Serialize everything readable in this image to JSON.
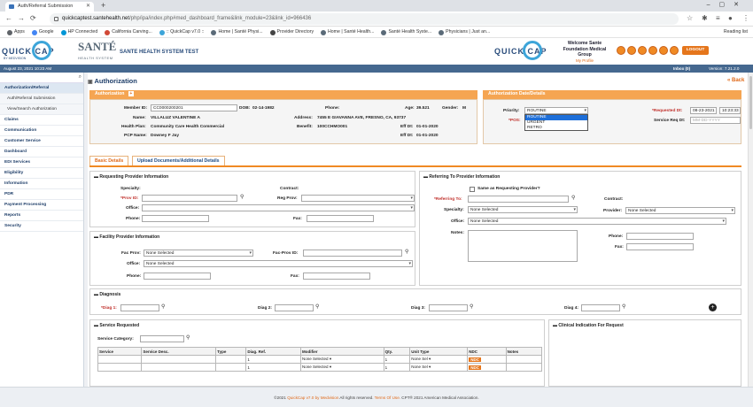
{
  "browser": {
    "tab_title": "Auth/Referral Submission",
    "url_host": "quickcaptest.santehealth.net",
    "url_path": "/php/ipa/index.php#med_dashboard_frame&link_module=23&link_id=966436",
    "bookmarks": [
      {
        "label": "Apps",
        "color": "#5f6368"
      },
      {
        "label": "Google",
        "color": "#4285f4"
      },
      {
        "label": "HP Connected",
        "color": "#0096d6"
      },
      {
        "label": "California Carving...",
        "color": "#d14836"
      },
      {
        "label": ":: QuickCap v7.0 ::",
        "color": "#3da5d9"
      },
      {
        "label": "Home | Santé Physi...",
        "color": "#5a6a78"
      },
      {
        "label": "Provider Directory",
        "color": "#444"
      },
      {
        "label": "Home | Santé Health...",
        "color": "#5a6a78"
      },
      {
        "label": "Santé Health Syste...",
        "color": "#5a6a78"
      },
      {
        "label": "Physicians | Just an...",
        "color": "#5a6a78"
      }
    ],
    "reading_list": "Reading list"
  },
  "header": {
    "logo_text": "QUICK CAP",
    "logo_sub": "BY MEDVISION",
    "sante_text": "SANTÉ",
    "sante_sub": "HEALTH SYSTEM",
    "system_name": "SANTE HEALTH SYSTEM TEST",
    "welcome": "Welcome Sante Foundation Medical Group",
    "my_profile": "My Profile",
    "logout": "LOGOUT"
  },
  "status": {
    "datetime": "August 23, 2021 10:23 AM",
    "inbox": "Inbox (0)",
    "version": "Version: 7.21.2.0"
  },
  "sidebar": {
    "items": [
      {
        "label": "Authorization/Referral",
        "sub": false,
        "active": true
      },
      {
        "label": "Auth/Referral Submission",
        "sub": true,
        "active": false
      },
      {
        "label": "View/Search Authorization",
        "sub": true,
        "active": false
      },
      {
        "label": "Claims",
        "sub": false,
        "active": false
      },
      {
        "label": "Communication",
        "sub": false,
        "active": false
      },
      {
        "label": "Customer Service",
        "sub": false,
        "active": false
      },
      {
        "label": "Dashboard",
        "sub": false,
        "active": false
      },
      {
        "label": "EDI Services",
        "sub": false,
        "active": false
      },
      {
        "label": "Eligibility",
        "sub": false,
        "active": false
      },
      {
        "label": "Information",
        "sub": false,
        "active": false
      },
      {
        "label": "PDR",
        "sub": false,
        "active": false
      },
      {
        "label": "Payment Processing",
        "sub": false,
        "active": false
      },
      {
        "label": "Reports",
        "sub": false,
        "active": false
      },
      {
        "label": "Security",
        "sub": false,
        "active": false
      }
    ]
  },
  "page": {
    "title": "Authorization",
    "back": "« Back"
  },
  "auth_panel": {
    "heading": "Authorization",
    "member_id_label": "Member ID:",
    "member_id": "CC0000200201",
    "dob_label": "DOB:",
    "dob": "02-14-1982",
    "phone_label": "Phone:",
    "age_label": "Age:",
    "age": "39.521",
    "gender_label": "Gender:",
    "gender": "M",
    "name_label": "Name:",
    "name": "VILLALUZ VALENTINE A",
    "address_label": "Address:",
    "address": "7455 E GIAVANNA AVE, FRESNO, CA, 93737",
    "health_plan_label": "Health Plan:",
    "health_plan": "Community Care Health Commercial",
    "benefit_label": "Benefit:",
    "benefit": "100CCHMO001",
    "effdt_label": "Eff Dt:",
    "effdt1": "01-01-2020",
    "pcp_label": "PCP Name:",
    "pcp": "Downey F Jay",
    "effdt2": "01-01-2020"
  },
  "dates_panel": {
    "heading": "Authorization Date/Details",
    "priority_label": "Priority:",
    "priority_value": "ROUTINE",
    "priority_options": [
      "ROUTINE",
      "URGENT",
      "RETRO"
    ],
    "pos_label": "*POS:",
    "requested_label": "*Requested Dt:",
    "requested_date": "08-23-2021",
    "requested_time": "10:23:33",
    "service_req_label": "Service Req Dt:",
    "service_req_ph": "MM-DD-YYYY"
  },
  "tabs": [
    "Basic Details",
    "Upload Documents/Additional Details"
  ],
  "requesting": {
    "heading": "Requesting Provider Information",
    "specialty": "Specialty:",
    "contract": "Contract:",
    "prov_id": "*Prov ID:",
    "req_prov": "Reg Prov:",
    "office": "Office:",
    "phone": "Phone:",
    "fax": "Fax:"
  },
  "facility": {
    "heading": "Facility Provider Information",
    "fac_prov": "Fac Prov:",
    "fac_prov_value": "None Selected",
    "fac_prov_id": "Fac-Prov ID:",
    "office": "Office:",
    "office_value": "None Selected",
    "phone": "Phone:",
    "fax": "Fax:"
  },
  "referring": {
    "heading": "Referring To Provider Information",
    "same_as": "Same as Requesting Provider?",
    "referring_to": "*Referring To:",
    "contract": "Contract:",
    "specialty": "Specialty:",
    "specialty_value": "None Selected",
    "provider": "Provider:",
    "provider_value": "None Selected",
    "office": "Office:",
    "office_value": "None Selected",
    "notes": "Notes:",
    "phone": "Phone:",
    "fax": "Fax:"
  },
  "diagnosis": {
    "heading": "Diagnosis",
    "diag1": "*Diag 1:",
    "diag2": "Diag 2:",
    "diag3": "Diag 3:",
    "diag4": "Diag 4:"
  },
  "service": {
    "heading": "Service Requested",
    "category": "Service Category:",
    "columns": [
      "Service",
      "Service Desc.",
      "Type",
      "Diag. Ref.",
      "Modifier",
      "Qty.",
      "Unit Type",
      "NDC",
      "Notes"
    ],
    "rows": [
      {
        "diag": "1",
        "modifier": "None Selected",
        "qty": "1",
        "unit": "None Sel",
        "ndc": "NDC"
      },
      {
        "diag": "1",
        "modifier": "None Selected",
        "qty": "1",
        "unit": "None Sel",
        "ndc": "NDC"
      }
    ]
  },
  "clinical": {
    "heading": "Clinical Indication For Request"
  },
  "footer": {
    "copy": "©2021",
    "quickcap": "QuickCap v7.0 by Medvision",
    "rights": " All rights reserved. ",
    "terms": "Terms Of Use.",
    "cpt": " CPT® 2021 American Medical Association."
  }
}
